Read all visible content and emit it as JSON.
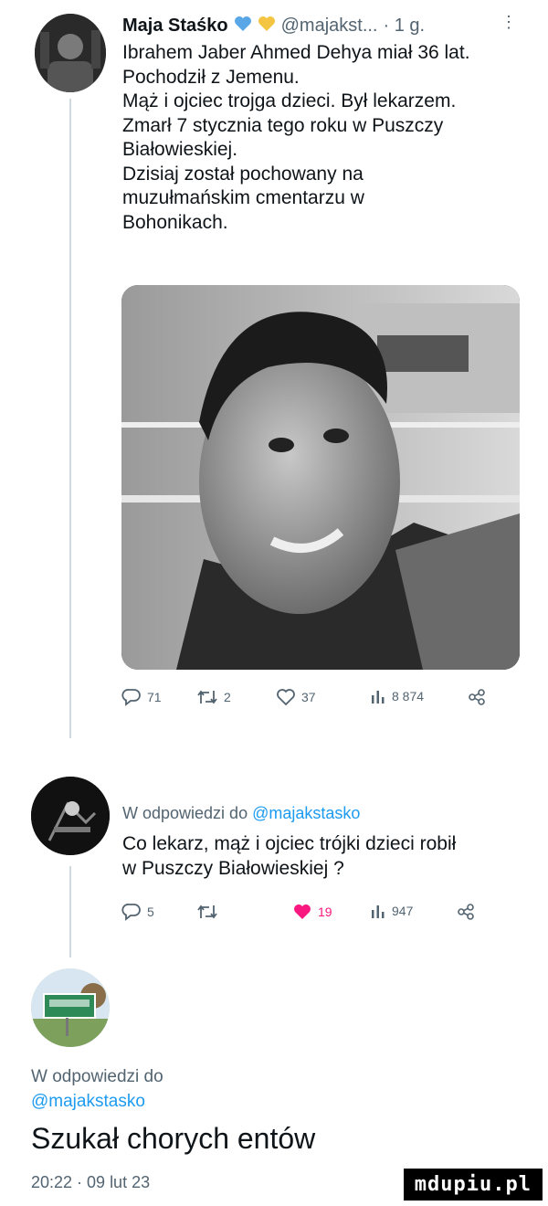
{
  "tweet": {
    "author_name": "Maja Staśko",
    "author_handle": "@majakst...",
    "time": "· 1 g.",
    "more": "⋮",
    "text_lines": [
      "Ibrahem Jaber Ahmed Dehya miał 36 lat.",
      "Pochodził z Jemenu.",
      "Mąż i ojciec trojga dzieci. Był lekarzem.",
      "Zmarł 7 stycznia tego roku w Puszczy",
      "Białowieskiej.",
      "Dzisiaj został pochowany na",
      "muzułmańskim cmentarzu w",
      "Bohonikach."
    ],
    "actions": {
      "replies": "71",
      "retweets": "2",
      "likes": "37",
      "views": "8 874"
    }
  },
  "reply1": {
    "replying_prefix": "W odpowiedzi do",
    "replying_handle": "@majakstasko",
    "text_lines": [
      "Co lekarz, mąż i ojciec trójki dzieci robił",
      "w Puszczy Białowieskiej ?"
    ],
    "actions": {
      "replies": "5",
      "retweets": "",
      "likes": "19",
      "views": "947"
    }
  },
  "reply2": {
    "replying_prefix": "W odpowiedzi do",
    "replying_handle": "@majakstasko",
    "text": "Szukał chorych entów",
    "timestamp": "20:22 · 09 lut 23"
  },
  "watermark": "mdupiu.pl",
  "colors": {
    "accent": "#1d9bf0",
    "like_red": "#f91880",
    "muted": "#536471",
    "thread": "#cfd9de"
  }
}
